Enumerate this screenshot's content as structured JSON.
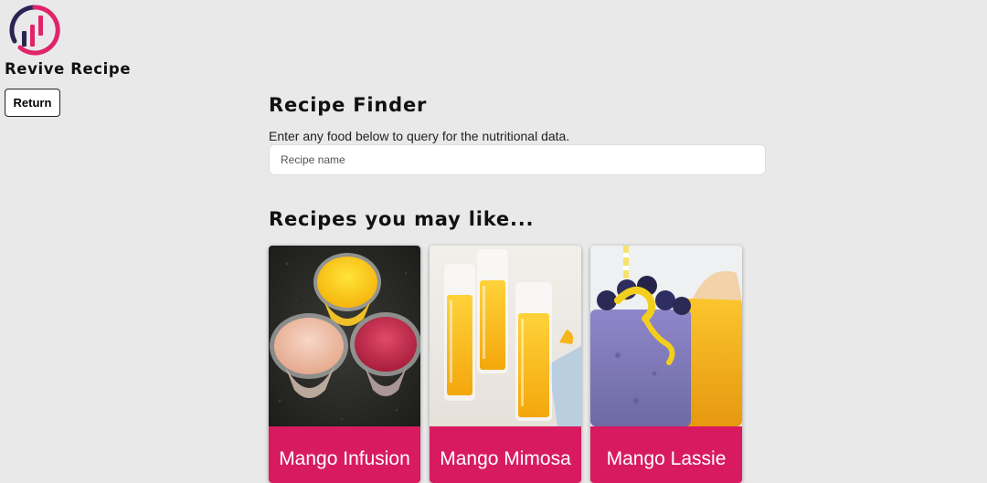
{
  "brand": {
    "logo_icon": "revive-recipe-logo-icon",
    "name": "Revive Recipe"
  },
  "nav": {
    "return_label": "Return"
  },
  "finder": {
    "title": "Recipe Finder",
    "instruction": "Enter any food below to query for the nutritional data.",
    "search_placeholder": "Recipe name",
    "search_value": ""
  },
  "suggestions": {
    "title": "Recipes you may like...",
    "cards": [
      {
        "label": "Mango Infusion",
        "image_icon": "mango-infusion-photo"
      },
      {
        "label": "Mango Mimosa",
        "image_icon": "mango-mimosa-photo"
      },
      {
        "label": "Mango Lassie",
        "image_icon": "mango-lassie-photo"
      }
    ]
  },
  "colors": {
    "background": "#e9e9e9",
    "card_label_bg": "#d81b60",
    "logo_navy": "#2a2553",
    "logo_pink": "#e0246a"
  }
}
